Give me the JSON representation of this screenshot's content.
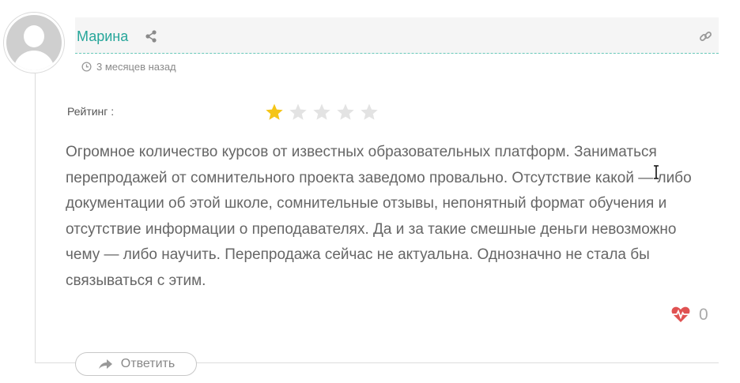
{
  "comment": {
    "author": "Марина",
    "time_ago": "3 месяцев назад",
    "rating_label": "Рейтинг :",
    "rating": {
      "value": 1,
      "max": 5
    },
    "text": "Огромное количество курсов от известных образовательных платформ. Заниматься перепродажей от сомнительного проекта заведомо провально. Отсутствие какой — либо документации об этой школе, сомнительные отзывы, непонятный формат обучения и отсутствие информации о преподавателях. Да и за такие смешные деньги невозможно чему — либо научить. Перепродажа сейчас не актуальна. Однозначно не стала бы связываться с этим.",
    "likes": "0",
    "reply_label": "Ответить"
  },
  "colors": {
    "author": "#26a69a",
    "star_filled": "#f5c518",
    "star_empty": "#e3e3e3",
    "heart": "#e05252"
  },
  "icons": [
    "avatar-placeholder",
    "share-icon",
    "link-icon",
    "clock-icon",
    "star-icon",
    "heart-pulse-icon",
    "reply-arrow-icon"
  ]
}
